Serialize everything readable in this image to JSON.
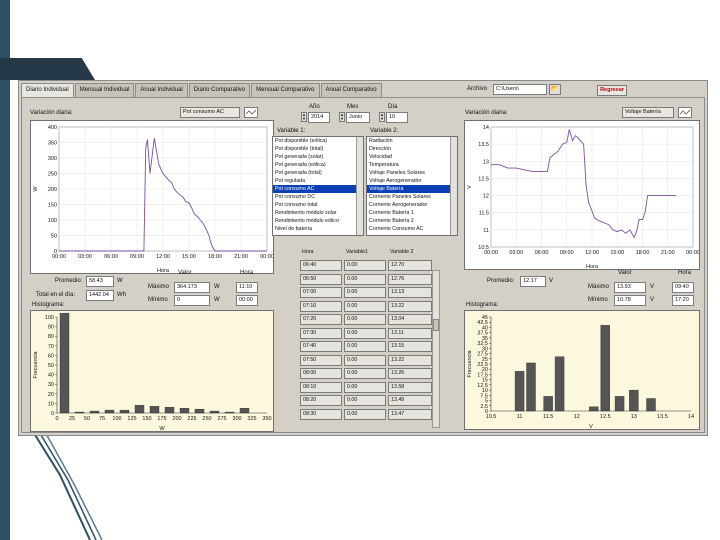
{
  "tabs": [
    "Diario Individual",
    "Mensual Individual",
    "Anual Individual",
    "Diario Comparativo",
    "Mensual Comparativo",
    "Anual Comparativo"
  ],
  "archivo": {
    "label": "Archivo",
    "value": "C:\\Users\\"
  },
  "regresar_label": "Regresar",
  "date": {
    "anio_label": "Año",
    "anio": "2014",
    "mes_label": "Mes",
    "mes": "Junio",
    "dia_label": "Día",
    "dia": "10"
  },
  "left": {
    "variacion_label": "Variación diaria:",
    "selector": "Pot consumo AC",
    "xlabel": "Hora",
    "ylabel": "W",
    "x_ticks": [
      "00:00",
      "03:00",
      "06:00",
      "09:00",
      "12:00",
      "15:00",
      "18:00",
      "21:00",
      "00:00"
    ],
    "y_ticks": [
      "0",
      "50",
      "100",
      "150",
      "200",
      "250",
      "300",
      "350",
      "400"
    ],
    "promedio_label": "Promedio:",
    "promedio": "58.43",
    "promedio_unit": "W",
    "total_label": "Total en el día:",
    "total": "1442.04",
    "total_unit": "Wh",
    "valor_label": "Valor",
    "hora_label": "Hora",
    "maximo_label": "Máximo",
    "maximo": "364.173",
    "maximo_unit": "W",
    "maximo_hora": "11:10",
    "minimo_label": "Mínimo",
    "minimo": "0",
    "minimo_unit": "W",
    "minimo_hora": "00:00",
    "histograma_label": "Histograma:",
    "hist_xlabel": "W",
    "hist_ylabel": "Frecuencia",
    "hist_x_ticks": [
      "0",
      "25",
      "50",
      "75",
      "100",
      "125",
      "150",
      "175",
      "200",
      "225",
      "250",
      "275",
      "300",
      "325",
      "350"
    ],
    "hist_y_ticks": [
      "0",
      "10",
      "20",
      "30",
      "40",
      "50",
      "60",
      "70",
      "80",
      "90",
      "100"
    ]
  },
  "right": {
    "variacion_label": "Variación diaria:",
    "selector": "Voltaje Batería",
    "xlabel": "Hora",
    "ylabel": "V",
    "x_ticks": [
      "00:00",
      "03:00",
      "06:00",
      "09:00",
      "12:00",
      "15:00",
      "18:00",
      "21:00",
      "00:00"
    ],
    "y_ticks": [
      "10.5",
      "11",
      "11.5",
      "12",
      "12.5",
      "13",
      "13.5",
      "14"
    ],
    "promedio_label": "Promedio:",
    "promedio": "12.17",
    "promedio_unit": "V",
    "valor_label": "Valor",
    "hora_label": "Hora",
    "maximo_label": "Máximo",
    "maximo": "13.93",
    "maximo_unit": "V",
    "maximo_hora": "09:40",
    "minimo_label": "Mínimo",
    "minimo": "10.78",
    "minimo_unit": "V",
    "minimo_hora": "17:20",
    "histograma_label": "Histograma:",
    "hist_xlabel": "V",
    "hist_ylabel": "Frecuencia",
    "hist_x_ticks": [
      "10.5",
      "11",
      "11.5",
      "12",
      "12.5",
      "13",
      "13.5",
      "14"
    ],
    "hist_y_ticks": [
      "0",
      "2.5",
      "5",
      "7.5",
      "10",
      "12.5",
      "15",
      "17.5",
      "20",
      "22.5",
      "25",
      "27.5",
      "30",
      "32.5",
      "35",
      "37.5",
      "40",
      "42.5",
      "45"
    ]
  },
  "variable1": {
    "label": "Variable 1:",
    "items": [
      "Pot disponible (eólica)",
      "Pot disponible (total)",
      "Pot generada (solar)",
      "Pot generada (eólica)",
      "Pot generada (total)",
      "Pot regulada",
      "Pot consumo AC",
      "Pot consumo DC",
      "Pot consumo total",
      "Rendimiento módulo solar",
      "Rendimiento módulo eólico",
      "Nivel de batería"
    ],
    "selected_index": 6
  },
  "variable2": {
    "label": "Variable 2:",
    "items": [
      "Radiación",
      "Dirección",
      "Velocidad",
      "Temperatura",
      "Voltaje Paneles Solares",
      "Voltaje Aerogenerador",
      "Voltaje Batería",
      "Corriente Paneles Solares",
      "Corriente Aerogenerador",
      "Corriente Batería 1",
      "Corriente Batería 2",
      "Corriente Consumo AC"
    ],
    "selected_index": 6
  },
  "table": {
    "headers": [
      "Hora",
      "Variable1",
      "Variable 2"
    ],
    "rows": [
      [
        "06:40",
        "0.00",
        "12.70"
      ],
      [
        "06:50",
        "0.00",
        "12.76"
      ],
      [
        "07:00",
        "0.00",
        "13.13"
      ],
      [
        "07:10",
        "0.00",
        "13.22"
      ],
      [
        "07:20",
        "0.00",
        "13.04"
      ],
      [
        "07:30",
        "0.00",
        "13.11"
      ],
      [
        "07:40",
        "0.00",
        "13.15"
      ],
      [
        "07:50",
        "0.00",
        "13.22"
      ],
      [
        "08:00",
        "0.00",
        "13.26"
      ],
      [
        "08:10",
        "0.00",
        "13.58"
      ],
      [
        "08:20",
        "0.00",
        "13.49"
      ],
      [
        "08:30",
        "0.00",
        "13.47"
      ]
    ]
  },
  "chart_data": [
    {
      "type": "line",
      "name": "left-daily",
      "x": [
        0,
        1,
        2,
        3,
        4,
        5,
        6,
        7,
        8,
        9,
        9.8,
        10,
        10.2,
        10.5,
        11,
        11.2,
        11.5,
        12,
        12.3,
        12.6,
        13,
        13.3,
        13.6,
        14,
        14.3,
        14.6,
        15,
        15.3,
        15.6,
        16,
        16.3,
        16.6,
        17,
        17.3,
        17.6,
        18,
        18.5,
        19,
        20,
        21,
        22,
        23,
        24
      ],
      "y": [
        0,
        0,
        0,
        0,
        0,
        0,
        0,
        0,
        0,
        0,
        0,
        330,
        360,
        250,
        364,
        330,
        280,
        250,
        240,
        230,
        220,
        200,
        190,
        180,
        175,
        160,
        155,
        140,
        120,
        110,
        100,
        90,
        70,
        50,
        20,
        0,
        0,
        0,
        0,
        0,
        0,
        0,
        0
      ],
      "xlabel": "Hora",
      "ylabel": "W",
      "xlim": [
        0,
        24
      ],
      "ylim": [
        0,
        400
      ]
    },
    {
      "type": "line",
      "name": "right-daily",
      "x": [
        0,
        1,
        2,
        3,
        4,
        5,
        6,
        6.7,
        7,
        7.5,
        8,
        8.5,
        9,
        9.3,
        9.7,
        10,
        10.3,
        10.6,
        11,
        11.3,
        11.6,
        12,
        12.3,
        12.6,
        13,
        13.5,
        14,
        14.5,
        15,
        15.5,
        16,
        16.5,
        17,
        17.3,
        17.6,
        18,
        18.3,
        18.6,
        19,
        20,
        21,
        22
      ],
      "y": [
        12.9,
        12.9,
        12.8,
        12.8,
        12.75,
        12.7,
        12.7,
        12.7,
        13.1,
        13.2,
        13.3,
        13.5,
        13.55,
        13.93,
        13.6,
        13.75,
        13.7,
        13.6,
        13.5,
        12.3,
        11.8,
        11.55,
        11.35,
        11.3,
        11.25,
        11.2,
        11.15,
        11.0,
        10.95,
        11.0,
        10.9,
        11.0,
        10.78,
        10.95,
        11.3,
        11.3,
        11.5,
        12.0,
        12.0,
        12.0,
        12.0,
        12.0
      ],
      "xlabel": "Hora",
      "ylabel": "V",
      "xlim": [
        0,
        24
      ],
      "ylim": [
        10.5,
        14
      ]
    },
    {
      "type": "bar",
      "name": "left-histogram",
      "categories": [
        "25",
        "50",
        "75",
        "100",
        "125",
        "150",
        "175",
        "200",
        "225",
        "250",
        "275",
        "300",
        "325",
        "350"
      ],
      "values": [
        104,
        1,
        2,
        3,
        3,
        8,
        7,
        6,
        5,
        4,
        2,
        1,
        5,
        0
      ],
      "xlabel": "W",
      "ylabel": "Frecuencia",
      "xlim": [
        0,
        350
      ],
      "ylim": [
        0,
        100
      ]
    },
    {
      "type": "bar",
      "name": "right-histogram",
      "x": [
        10.8,
        11.0,
        11.2,
        11.5,
        11.7,
        12.0,
        12.3,
        12.5,
        12.75,
        13.0,
        13.3,
        13.5,
        13.75
      ],
      "values": [
        0,
        19,
        23,
        7,
        26,
        0,
        2,
        41,
        7,
        10,
        6,
        0,
        0
      ],
      "xlabel": "V",
      "ylabel": "Frecuencia",
      "xlim": [
        10.5,
        14
      ],
      "ylim": [
        0,
        45
      ]
    }
  ]
}
